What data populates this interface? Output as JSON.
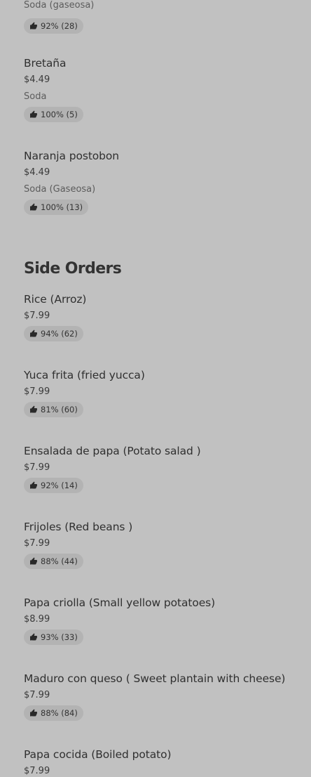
{
  "drinks_tail": {
    "item0": {
      "desc": "Soda (gaseosa)",
      "rating": "92% (28)"
    },
    "item1": {
      "name": "Bretaña",
      "price": "$4.49",
      "desc": "Soda",
      "rating": "100% (5)"
    },
    "item2": {
      "name": "Naranja postobon",
      "price": "$4.49",
      "desc": "Soda (Gaseosa)",
      "rating": "100% (13)"
    }
  },
  "side_orders": {
    "title": "Side Orders",
    "items": [
      {
        "name": "Rice (Arroz)",
        "price": "$7.99",
        "rating": "94% (62)"
      },
      {
        "name": "Yuca frita (fried yucca)",
        "price": "$7.99",
        "rating": "81% (60)"
      },
      {
        "name": "Ensalada de papa (Potato salad )",
        "price": "$7.99",
        "rating": "92% (14)"
      },
      {
        "name": "Frijoles (Red beans )",
        "price": "$7.99",
        "rating": "88% (44)"
      },
      {
        "name": "Papa criolla (Small yellow potatoes)",
        "price": "$8.99",
        "rating": "93% (33)"
      },
      {
        "name": "Maduro con queso ( Sweet plantain with cheese)",
        "price": "$7.99",
        "rating": "88% (84)"
      },
      {
        "name": "Papa cocida (Boiled potato)",
        "price": "$7.99"
      }
    ]
  },
  "icons": {
    "rating": "thumbs-up-icon"
  },
  "colors": {
    "background": "#c1c1c1",
    "badge": "#b3b3b3",
    "text": "#303030",
    "muted": "#5c5c5c"
  }
}
